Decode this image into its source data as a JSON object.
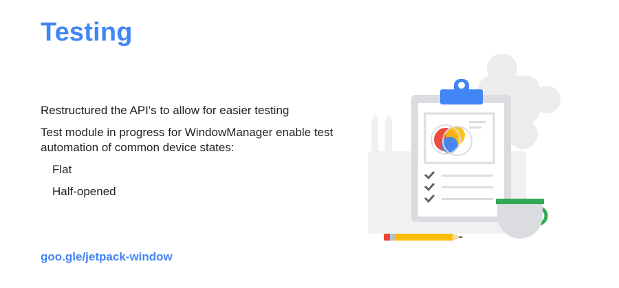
{
  "slide": {
    "title": "Testing",
    "bullets": [
      "Restructured the API's to allow for easier testing",
      "Test module in progress for WindowManager enable test automation of common device states:"
    ],
    "sub_bullets": [
      "Flat",
      "Half-opened"
    ],
    "link": "goo.gle/jetpack-window"
  },
  "colors": {
    "title": "#4285F4",
    "text": "#202124",
    "blue": "#4285F4",
    "red": "#EA4335",
    "yellow": "#FBBC04",
    "green": "#34A853"
  },
  "illustration": {
    "icons": [
      "clipboard-icon",
      "venn-diagram-icon",
      "checkmark-icon",
      "pencil-icon",
      "coffee-cup-icon",
      "puzzle-piece-icon"
    ]
  }
}
